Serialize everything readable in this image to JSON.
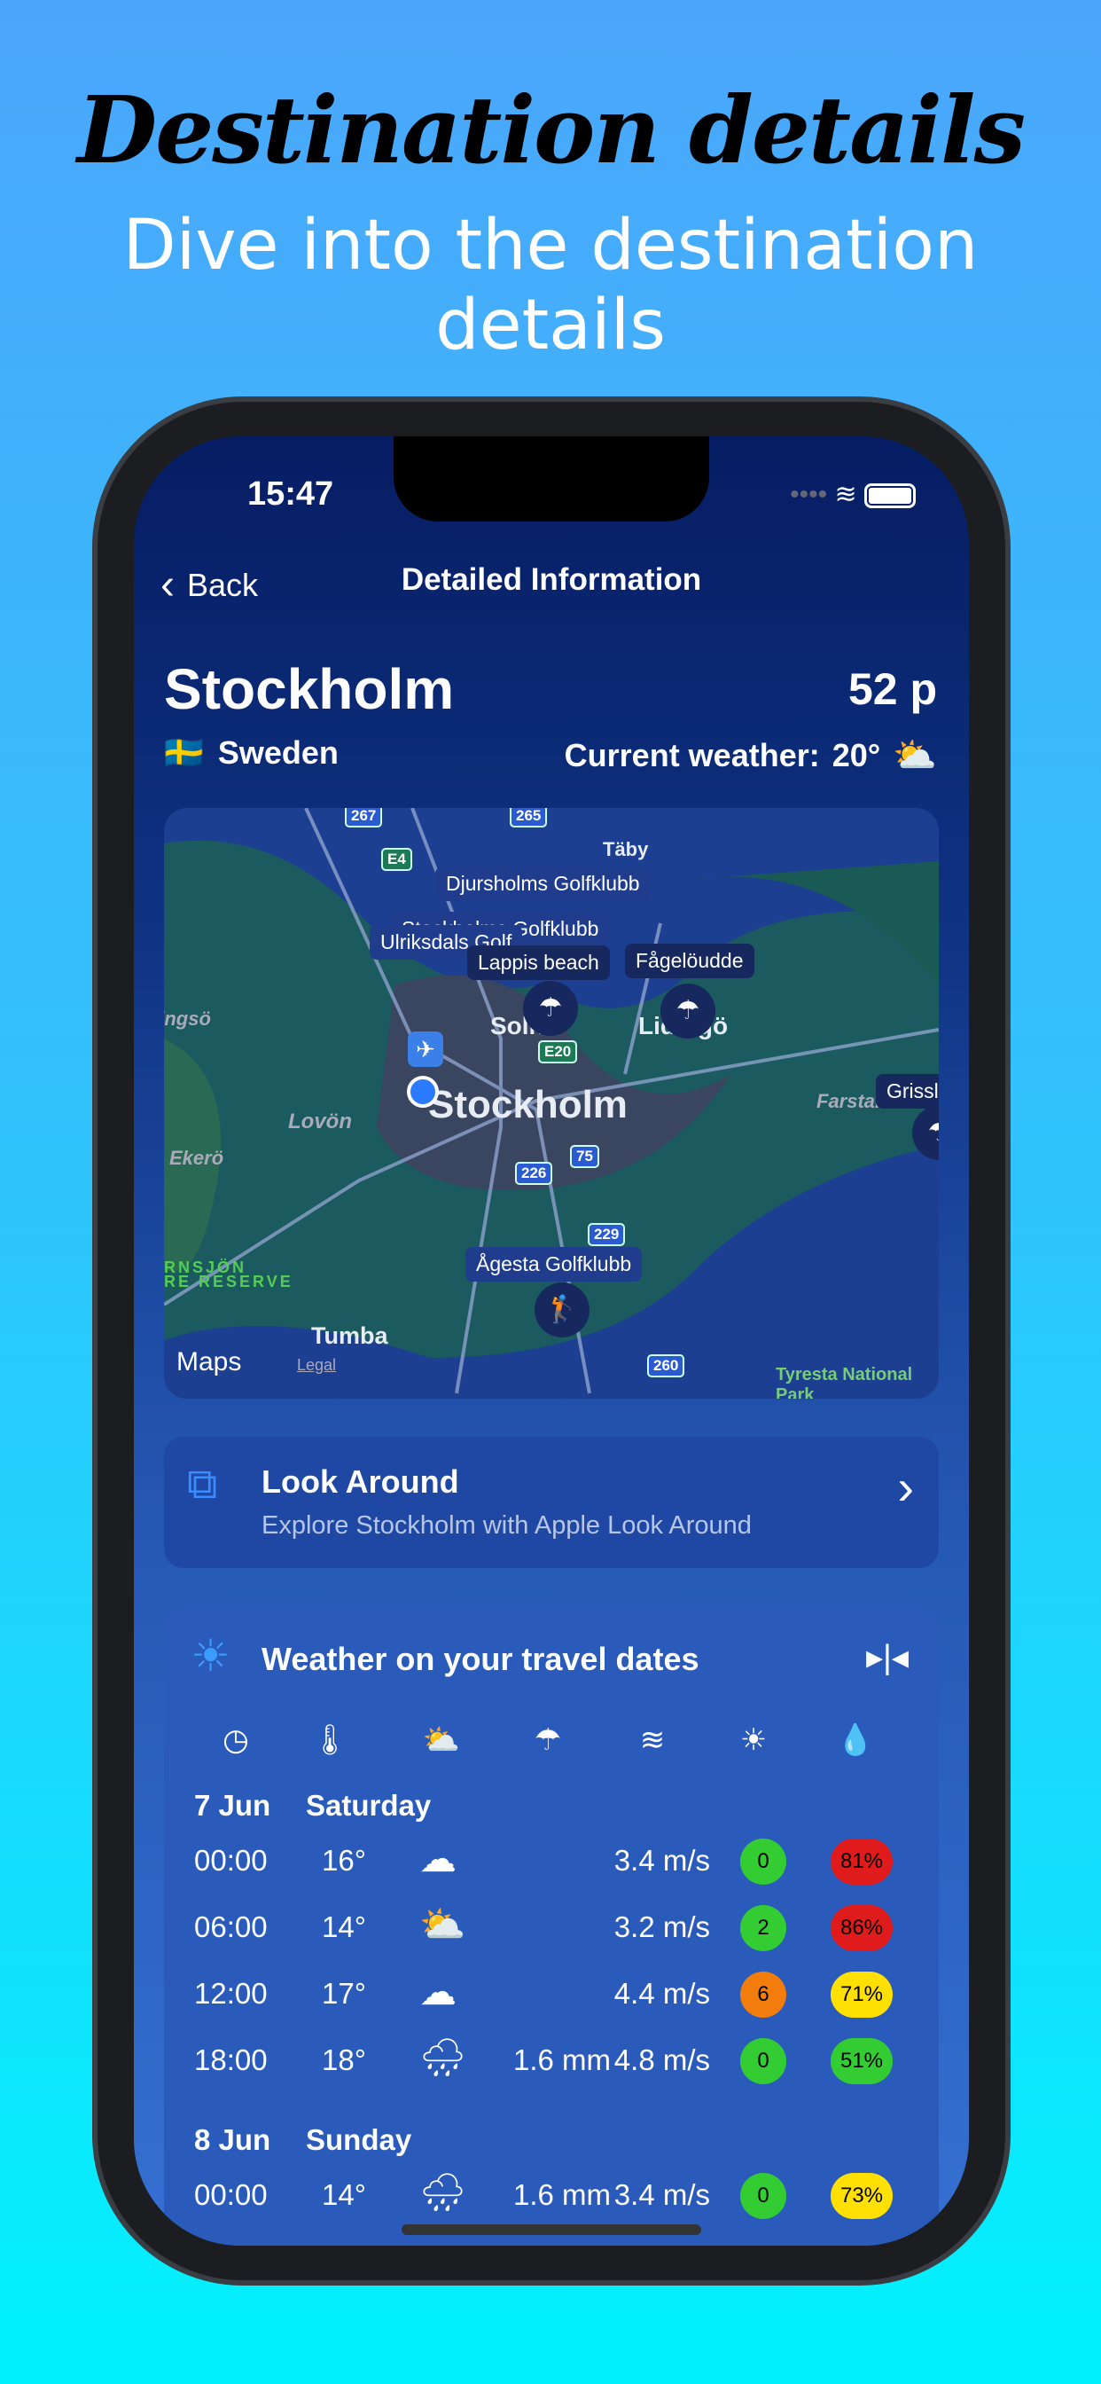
{
  "promo": {
    "headline": "Destination details",
    "subline": "Dive into the destination details"
  },
  "status_bar": {
    "time": "15:47",
    "icons": [
      "signal-icon",
      "wifi-icon",
      "battery-icon"
    ]
  },
  "nav": {
    "back_label": "Back",
    "title": "Detailed Information"
  },
  "destination": {
    "city": "Stockholm",
    "points": "52 p",
    "flag": "🇸🇪",
    "country": "Sweden",
    "current_weather_label": "Current weather:",
    "current_temp": "20°",
    "current_icon": "partly-sunny-icon"
  },
  "map": {
    "pins": [
      "Djursholms Golfklubb",
      "Stockholms Golfklubb",
      "Ulriksdals Golf",
      "Lappis beach",
      "Fågelöudde",
      "Ågesta Golfklubb",
      "Grissl"
    ],
    "places": [
      "Stockholm",
      "Solna",
      "Lidingö",
      "Lovön",
      "Ekerö",
      "Tumba",
      "Färingsö",
      "Farstalandet",
      "Täby",
      "Tyresta National Park",
      "RNSJÖN",
      "RE RESERVE"
    ],
    "roads": [
      "267",
      "265",
      "E4",
      "E20",
      "75",
      "226",
      "229",
      "260"
    ],
    "attribution": "Maps",
    "legal": "Legal"
  },
  "look_around": {
    "title": "Look Around",
    "subtitle": "Explore Stockholm with Apple Look Around"
  },
  "weather": {
    "title": "Weather on your travel dates",
    "columns": [
      "time-icon",
      "temperature-icon",
      "condition-icon",
      "precipitation-icon",
      "wind-icon",
      "uv-icon",
      "humidity-icon"
    ],
    "colors": {
      "green": "#33cc33",
      "orange": "#f27d0c",
      "yellow": "#ffe000",
      "red": "#e01b1b"
    },
    "days": [
      {
        "date": "7 Jun",
        "weekday": "Saturday",
        "rows": [
          {
            "time": "00:00",
            "temp": "16°",
            "icon": "cloud",
            "precip": "",
            "wind": "3.4 m/s",
            "uv": "0",
            "uv_color": "#33cc33",
            "humidity": "81%",
            "hum_color": "#e01b1b"
          },
          {
            "time": "06:00",
            "temp": "14°",
            "icon": "partly-sunny",
            "precip": "",
            "wind": "3.2 m/s",
            "uv": "2",
            "uv_color": "#33cc33",
            "humidity": "86%",
            "hum_color": "#e01b1b"
          },
          {
            "time": "12:00",
            "temp": "17°",
            "icon": "cloud",
            "precip": "",
            "wind": "4.4 m/s",
            "uv": "6",
            "uv_color": "#f27d0c",
            "humidity": "71%",
            "hum_color": "#ffe000"
          },
          {
            "time": "18:00",
            "temp": "18°",
            "icon": "rain",
            "precip": "1.6 mm",
            "wind": "4.8 m/s",
            "uv": "0",
            "uv_color": "#33cc33",
            "humidity": "51%",
            "hum_color": "#33cc33"
          }
        ]
      },
      {
        "date": "8 Jun",
        "weekday": "Sunday",
        "rows": [
          {
            "time": "00:00",
            "temp": "14°",
            "icon": "rain",
            "precip": "1.6 mm",
            "wind": "3.4 m/s",
            "uv": "0",
            "uv_color": "#33cc33",
            "humidity": "73%",
            "hum_color": "#ffe000"
          }
        ]
      }
    ]
  }
}
